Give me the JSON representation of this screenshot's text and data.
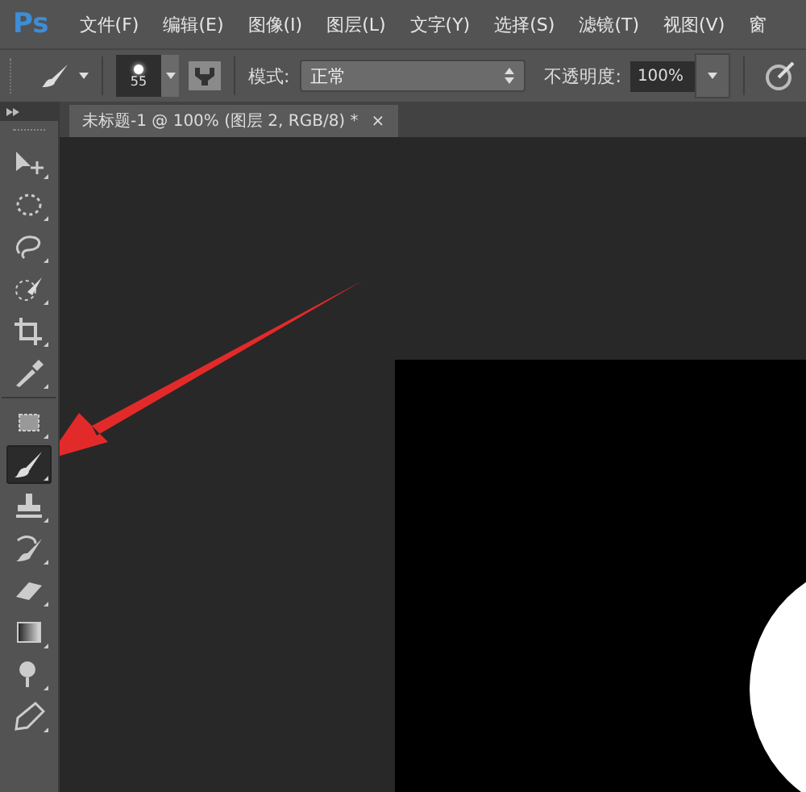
{
  "app": {
    "logo": "Ps"
  },
  "menu": [
    {
      "label": "文件(F)"
    },
    {
      "label": "编辑(E)"
    },
    {
      "label": "图像(I)"
    },
    {
      "label": "图层(L)"
    },
    {
      "label": "文字(Y)"
    },
    {
      "label": "选择(S)"
    },
    {
      "label": "滤镜(T)"
    },
    {
      "label": "视图(V)"
    },
    {
      "label": "窗"
    }
  ],
  "options": {
    "brush_size": "55",
    "mode_label": "模式:",
    "mode_value": "正常",
    "opacity_label": "不透明度:",
    "opacity_value": "100%"
  },
  "document_tab": {
    "title": "未标题-1 @ 100% (图层 2, RGB/8) *",
    "close": "×"
  },
  "tools": [
    {
      "kind": "move",
      "selected": false
    },
    {
      "kind": "marquee",
      "selected": false
    },
    {
      "kind": "lasso",
      "selected": false
    },
    {
      "kind": "quick",
      "selected": false
    },
    {
      "kind": "crop",
      "selected": false
    },
    {
      "kind": "eyedropper",
      "selected": false
    },
    {
      "kind": "patch",
      "selected": false
    },
    {
      "kind": "brush",
      "selected": true
    },
    {
      "kind": "stamp",
      "selected": false
    },
    {
      "kind": "history",
      "selected": false
    },
    {
      "kind": "eraser",
      "selected": false
    },
    {
      "kind": "gradient",
      "selected": false
    },
    {
      "kind": "dodge",
      "selected": false
    },
    {
      "kind": "pen",
      "selected": false
    }
  ]
}
